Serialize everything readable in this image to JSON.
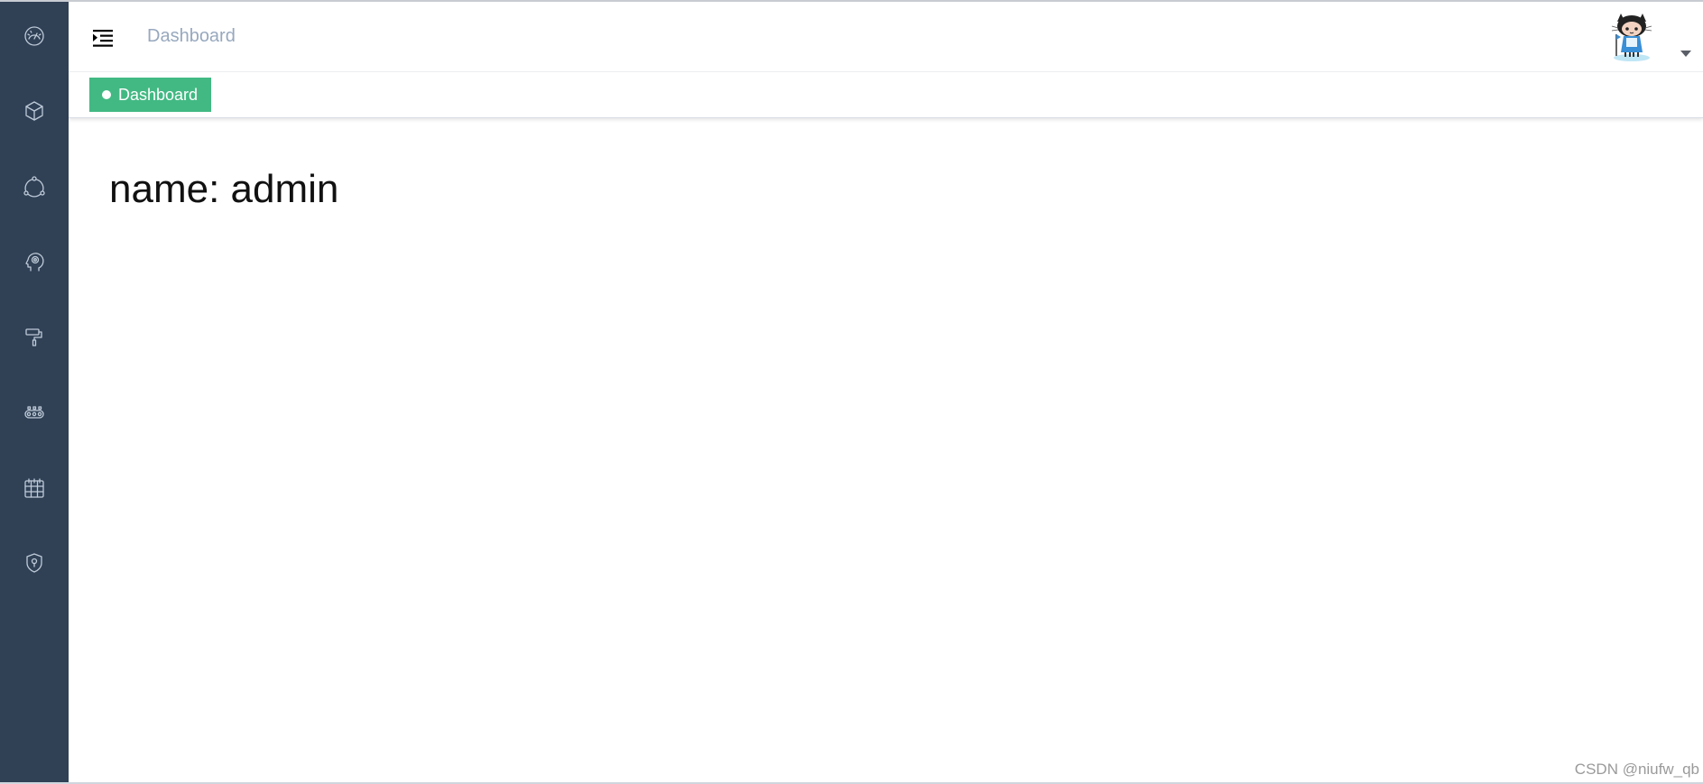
{
  "sidebar": {
    "background": "#304156",
    "items": [
      {
        "icon": "dashboard-gauge-icon"
      },
      {
        "icon": "cube-icon"
      },
      {
        "icon": "share-nodes-icon"
      },
      {
        "icon": "head-gear-icon"
      },
      {
        "icon": "paint-roller-icon"
      },
      {
        "icon": "conveyor-icon"
      },
      {
        "icon": "calendar-table-icon"
      },
      {
        "icon": "shield-location-icon"
      }
    ]
  },
  "navbar": {
    "breadcrumb": "Dashboard",
    "hamburger_icon": "menu-fold-icon",
    "avatar_icon": "octocat-avatar-icon",
    "dropdown_icon": "caret-down-icon"
  },
  "tags_view": {
    "active_tag": "Dashboard",
    "active_color": "#42b983"
  },
  "content": {
    "dashboard_text": "name: admin"
  },
  "watermark": "CSDN @niufw_qb"
}
